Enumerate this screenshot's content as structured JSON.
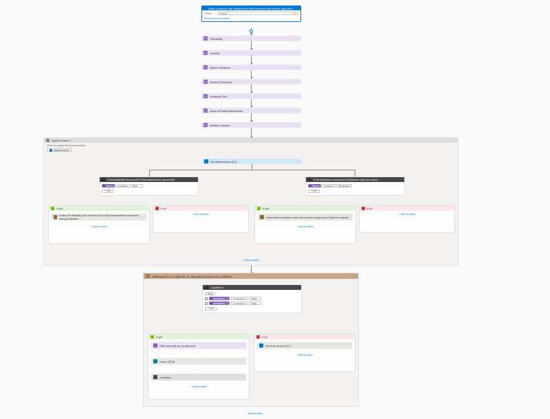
{
  "trigger": {
    "title": "When someone risk assessment with business over review appears it",
    "folder_label": "Folder",
    "folder_value": "Inbox",
    "advanced": "Show advanced options"
  },
  "vars": [
    "Probability",
    "Severity",
    "Speech Request",
    "Speech Response",
    "Extracted Text",
    "Array of Email Attachments",
    "Initialize variable"
  ],
  "foreach1": {
    "title": "Apply to each 2",
    "note": "Select an output from previous steps",
    "pill": "Attachments"
  },
  "getattach": "Get attachments (V2)",
  "cond1": {
    "title": "If the attached document is Risk Assessment document",
    "tag": "Name",
    "op": "contains",
    "val": "Risk",
    "add": "+ Add"
  },
  "cond2": {
    "title": "If the attached document is Business case document",
    "tag": "Name",
    "op": "contains",
    "val": "Business",
    "add": "+ Add"
  },
  "yes": "If yes",
  "no": "If no",
  "act1": "Extract Probability and Severity from Risk Assessment document using AI Builder",
  "act2": "Summarize business case documents using Azure OpenAI endpoint",
  "addaction": "Add an action",
  "scope": {
    "title": "Notify approver on high risk, or auto-approve lower-risk conditions"
  },
  "cond3": {
    "title": "Condition 2",
    "and": "And",
    "tag": "variables(...)",
    "op": "is equal to",
    "val": "High",
    "add": "+ Add"
  },
  "approval": "Start and wait for an approval",
  "parse": "Parse JSON",
  "condition": "Condition",
  "sendemail": "Send an email (V2) 2"
}
